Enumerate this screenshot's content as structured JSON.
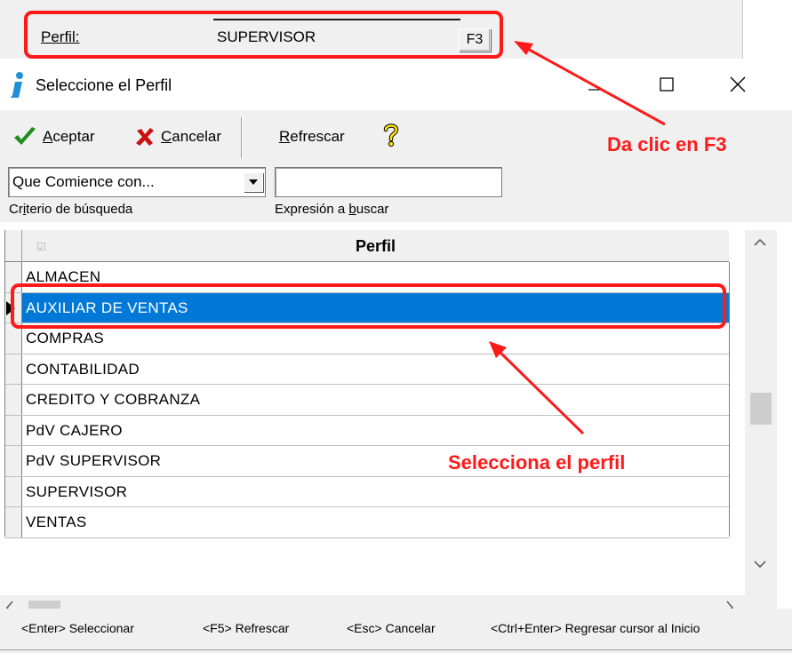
{
  "parent_form": {
    "perfil_label": "Perfil:",
    "perfil_value": "SUPERVISOR",
    "f3_button": "F3"
  },
  "dialog": {
    "title": "Seleccione el Perfil",
    "app_icon": "info-i-icon",
    "window_controls": {
      "minimize": "—",
      "maximize": "☐",
      "close": "✕"
    }
  },
  "toolbar": {
    "aceptar_prefix": "A",
    "aceptar_rest": "ceptar",
    "cancelar_prefix": "C",
    "cancelar_rest": "ancelar",
    "refrescar_prefix": "R",
    "refrescar_rest": "efrescar",
    "help_icon": "help-question-icon"
  },
  "search": {
    "criteria_value": "Que Comience con...",
    "criteria_label_a": "Cr",
    "criteria_label_u": "i",
    "criteria_label_b": "terio de búsqueda",
    "expr_value": "",
    "expr_label_a": "Expresión a ",
    "expr_label_u": "b",
    "expr_label_b": "uscar"
  },
  "grid": {
    "column_header": "Perfil",
    "rows": [
      "ALMACEN",
      "AUXILIAR DE VENTAS",
      "COMPRAS",
      "CONTABILIDAD",
      "CREDITO Y COBRANZA",
      "PdV CAJERO",
      "PdV SUPERVISOR",
      "SUPERVISOR",
      "VENTAS"
    ],
    "selected_index": 1
  },
  "statusbar": {
    "items": [
      "<Enter> Seleccionar",
      "<F5> Refrescar",
      "<Esc> Cancelar",
      "<Ctrl+Enter> Regresar cursor al Inicio"
    ]
  },
  "annotations": {
    "f3_text": "Da clic en F3",
    "perfil_text": "Selecciona el perfil",
    "color": "#ff1a1a"
  },
  "colors": {
    "selection": "#0078d7",
    "chrome": "#f0f0f0",
    "check": "#1e8c1e",
    "cancel_x": "#cc1010"
  }
}
